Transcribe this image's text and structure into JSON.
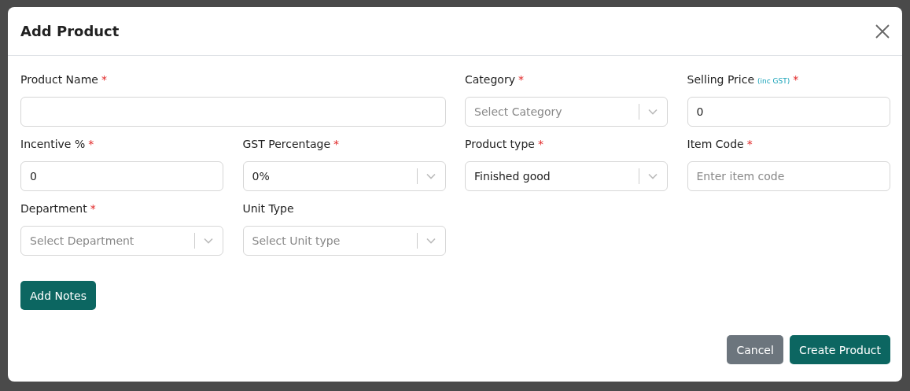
{
  "dialog": {
    "title": "Add Product"
  },
  "fields": [
    {
      "label": "Product Name",
      "required_mark": "*",
      "kind": "input",
      "wide": true
    },
    {
      "label": "Category",
      "required_mark": "*",
      "kind": "select",
      "placeholder": "Select Category",
      "wide": false
    },
    {
      "label": "Selling Price",
      "note": "(inc GST)",
      "required_mark": "*",
      "kind": "input",
      "value": "0",
      "wide": false
    },
    {
      "label": "Incentive %",
      "required_mark": "*",
      "kind": "input",
      "value": "0",
      "wide": false
    },
    {
      "label": "GST Percentage",
      "required_mark": "*",
      "kind": "select",
      "value": "0%",
      "wide": false
    },
    {
      "label": "Product type",
      "required_mark": "*",
      "kind": "select",
      "value": "Finished good",
      "wide": false
    },
    {
      "label": "Item Code",
      "required_mark": "*",
      "kind": "input",
      "placeholder": "Enter item code",
      "wide": false
    },
    {
      "label": "Department",
      "required_mark": "*",
      "kind": "select",
      "placeholder": "Select Department",
      "wide": false
    },
    {
      "label": "Unit Type",
      "kind": "select",
      "placeholder": "Select Unit type",
      "wide": false
    }
  ],
  "notes_button": "Add Notes",
  "buttons": [
    {
      "label": "Cancel",
      "kind": "secondary"
    },
    {
      "label": "Create Product",
      "kind": "primary"
    }
  ]
}
